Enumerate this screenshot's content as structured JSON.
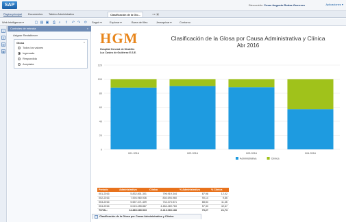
{
  "header": {
    "logo_text": "SAP",
    "welcome_prefix": "Bienvenido:",
    "user_name": "Cesar Augusto Rodas Guerrero",
    "applications": "Aplicaciones ▾"
  },
  "tabs": {
    "home": "Página principal",
    "documents": "Documentos",
    "admin_board": "Tablero Administrativo",
    "active_doc": "Clasificación de la Glo...",
    "controls": "◂  ▸  ▣"
  },
  "toolbar": {
    "app_name": "Web Intelligence ▾",
    "track": "Seguir ▾",
    "explore": "Explorar ▾",
    "filter_bar": "Barra de filtro",
    "outline": "Jerarquizar ▾",
    "contour": "Contorno"
  },
  "panel": {
    "title": "Controles de entrada",
    "close": "×",
    "actions": "Asignar   Restablecer",
    "glosa_title": "Glosa",
    "collapse": "«",
    "options": [
      {
        "label": "Todos los valores",
        "selected": false
      },
      {
        "label": "Ingresada",
        "selected": true
      },
      {
        "label": "Respondida",
        "selected": false
      },
      {
        "label": "Aceptada",
        "selected": false
      }
    ]
  },
  "report": {
    "logo_letters": "HGM",
    "org_line1": "Hospital General de Medellín",
    "org_line2": "Luz Castro de Gutiérrez E.S.E.",
    "title": "Clasificación de la Glosa por Causa Administrativa y Clínica",
    "subtitle": "Abr 2016"
  },
  "chart_data": {
    "type": "bar",
    "stacked": true,
    "categories": [
      "001-2016",
      "002-2016",
      "003-2016",
      "004-2016"
    ],
    "series": [
      {
        "name": "Administrativa",
        "color": "#1e9be0",
        "values": [
          87.98,
          90.14,
          88.54,
          57.33
        ]
      },
      {
        "name": "Clínica",
        "color": "#a0c21b",
        "values": [
          12.02,
          9.86,
          11.46,
          42.67
        ]
      }
    ],
    "y_ticks": [
      "120",
      "100",
      "80",
      "60",
      "40",
      "20",
      "0"
    ],
    "ylim": [
      0,
      120
    ],
    "legend_position": "bottom"
  },
  "table": {
    "headers": [
      "Periodo",
      "Administrativa",
      "Clínica",
      "% Administrativa",
      "% Clínica"
    ],
    "rows": [
      [
        "001-2016",
        "5.832.801.301",
        "796.919.344",
        "87,98",
        "12,02"
      ],
      [
        "002-2016",
        "7.594.960.936",
        "830.694.960",
        "90,14",
        "9,86"
      ],
      [
        "003-2016",
        "5.657.371.409",
        "732.373.571",
        "88,54",
        "11,46"
      ],
      [
        "004-2016",
        "6.024.455.887",
        "4.484.469.763",
        "57,33",
        "42,67"
      ]
    ],
    "total": [
      "TOTAL:",
      "24.889.689.533",
      "6.413.069.168",
      "79,27",
      "21,73"
    ]
  },
  "bottom_tab": {
    "label": "Clasificación de la Glosa por Causa Administrativa y Clínica"
  }
}
